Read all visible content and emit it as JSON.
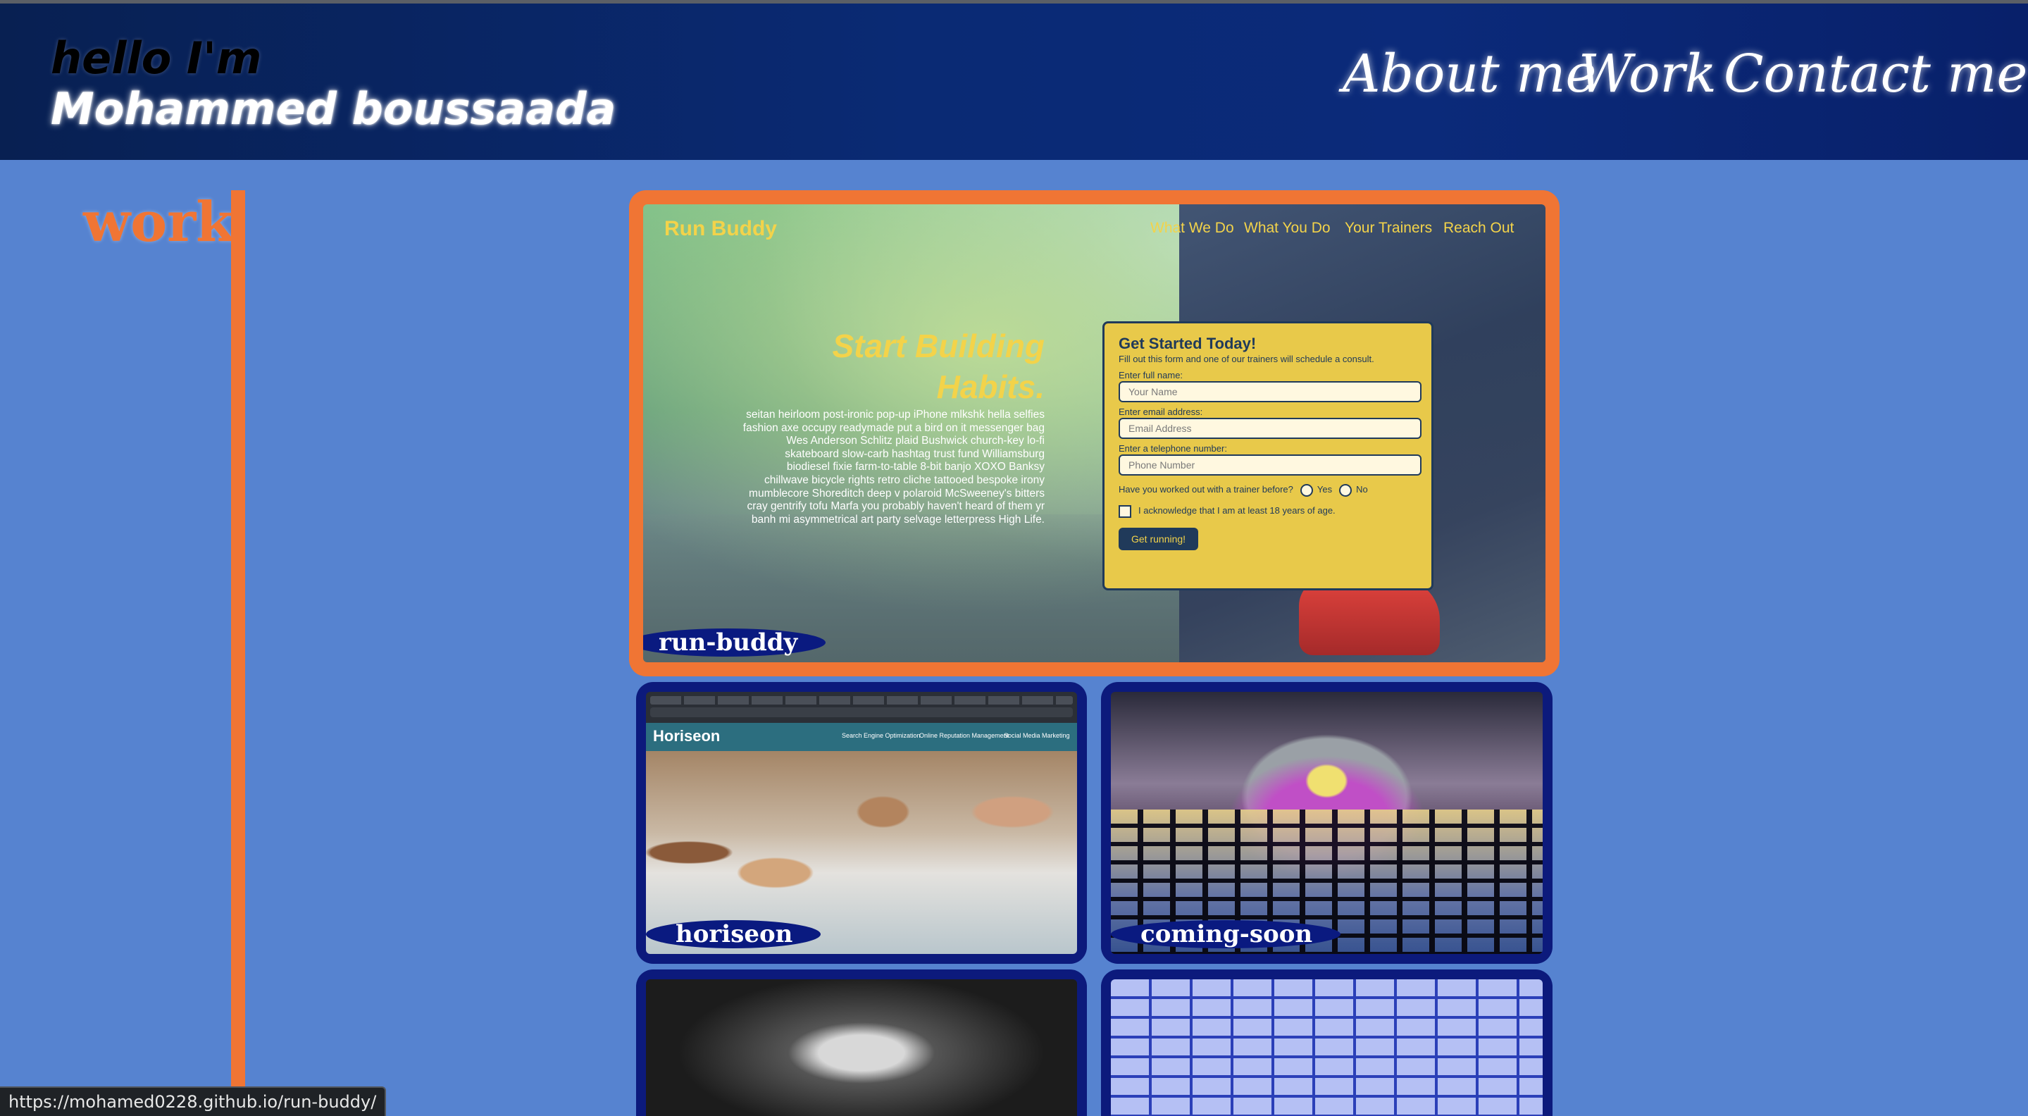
{
  "header": {
    "greeting": "hello I'm",
    "name": "Mohammed boussaada",
    "nav": [
      {
        "label": "About me"
      },
      {
        "label": "Work"
      },
      {
        "label": "Contact me"
      }
    ]
  },
  "sidebar": {
    "title": "work"
  },
  "projects": {
    "featured": {
      "label": "run-buddy",
      "preview": {
        "logo": "Run Buddy",
        "nav": [
          "What We Do",
          "What You Do",
          "Your Trainers",
          "Reach Out"
        ],
        "hero_title": "Start Building Habits.",
        "hero_text": "seitan heirloom post-ironic pop-up iPhone mlkshk hella selfies fashion axe occupy readymade put a bird on it messenger bag Wes Anderson Schlitz plaid Bushwick church-key lo-fi skateboard slow-carb hashtag trust fund Williamsburg biodiesel fixie farm-to-table 8-bit banjo XOXO Banksy chillwave bicycle rights retro cliche tattooed bespoke irony mumblecore Shoreditch deep v polaroid McSweeney's bitters cray gentrify tofu Marfa you probably haven't heard of them yr banh mi asymmetrical art party selvage letterpress High Life.",
        "form": {
          "title": "Get Started Today!",
          "subtitle": "Fill out this form and one of our trainers will schedule a consult.",
          "name_label": "Enter full name:",
          "name_placeholder": "Your Name",
          "email_label": "Enter email address:",
          "email_placeholder": "Email Address",
          "phone_label": "Enter a telephone number:",
          "phone_placeholder": "Phone Number",
          "trainer_question": "Have you worked out with a trainer before?",
          "yes": "Yes",
          "no": "No",
          "acknowledge": "I acknowledge that I am at least 18 years of age.",
          "submit": "Get running!"
        }
      }
    },
    "horiseon": {
      "label": "horiseon",
      "preview": {
        "logo": "Horiseon",
        "nav": [
          "Search Engine Optimization",
          "Online Reputation Management",
          "Social Media Marketing"
        ]
      }
    },
    "coming_soon": {
      "label": "coming-soon"
    }
  },
  "status_bar": {
    "url": "https://mohamed0228.github.io/run-buddy/"
  },
  "colors": {
    "accent": "#f07534",
    "header_bg": "#0a2a74",
    "page_bg": "#5683d0",
    "card_border": "#0c1a7c"
  }
}
